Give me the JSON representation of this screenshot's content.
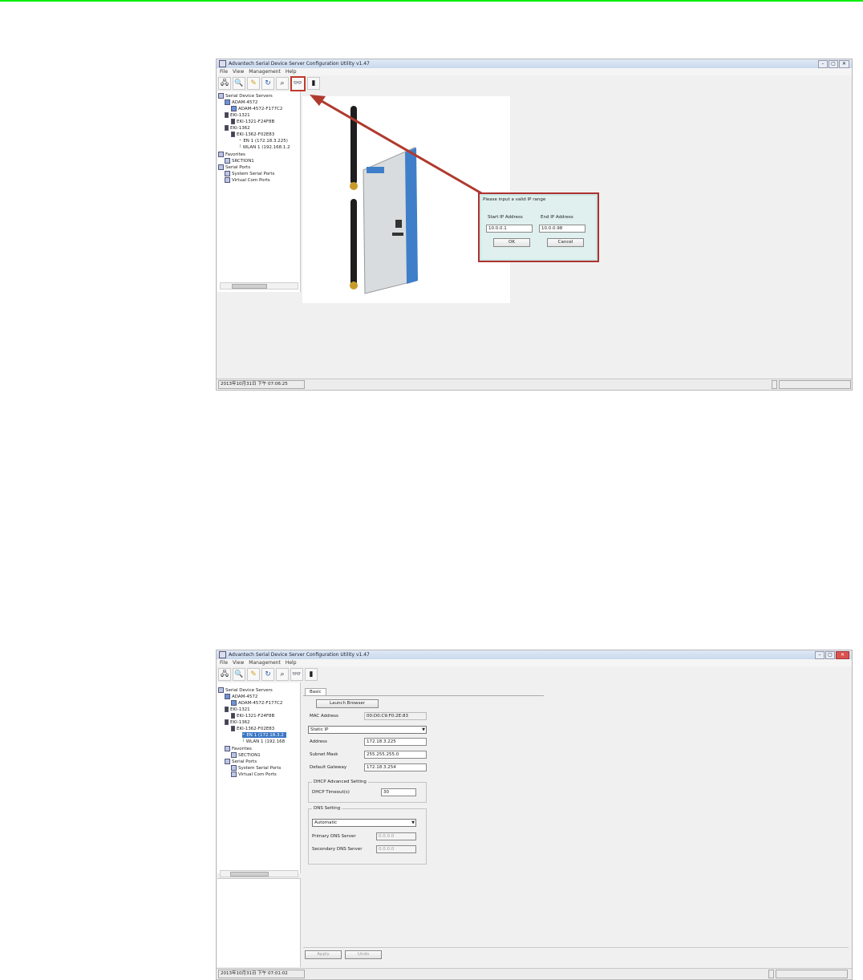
{
  "screenshot_top": {
    "title": "Advantech Serial Device Server Configuration Utility v1.47",
    "window_controls": [
      "–",
      "▢",
      "✕"
    ],
    "menu": [
      "File",
      "View",
      "Management",
      "Help"
    ],
    "toolbar_icons": [
      "network-icon",
      "search-icon",
      "edit-icon",
      "refresh-icon",
      "zoom-icon",
      "binoculars-icon",
      "door-icon"
    ],
    "highlighted_tool": "binoculars-icon",
    "tree": [
      {
        "label": "Serial Device Servers"
      },
      {
        "label": "ADAM-4572"
      },
      {
        "label": "ADAM-4572-F177C2"
      },
      {
        "label": "EKI-1321"
      },
      {
        "label": "EKI-1321-F24F8B"
      },
      {
        "label": "EKI-1362"
      },
      {
        "label": "EKI-1362-F02E83"
      },
      {
        "label": "EN 1 (172.18.3.225)"
      },
      {
        "label": "WLAN 1 (192.168.1.2"
      },
      {
        "label": "Favorites"
      },
      {
        "label": "SRCTION1"
      },
      {
        "label": "Serial Ports"
      },
      {
        "label": "System Serial Ports"
      },
      {
        "label": "Virtual Com Ports"
      }
    ],
    "dialog": {
      "title": "Please input a valid IP range",
      "start_label": "Start IP Address",
      "end_label": "End IP Address",
      "start_value": "10.0.0.1",
      "end_value": "10.0.0.98",
      "ok": "OK",
      "cancel": "Cancel"
    },
    "status": "2013年10月31日 下午 07:06:25",
    "colors": {
      "highlight": "#c0392b",
      "dialog_bg": "#dff0ee"
    }
  },
  "screenshot_bottom": {
    "title": "Advantech Serial Device Server Configuration Utility v1.47",
    "window_controls": [
      "–",
      "▢",
      "✕"
    ],
    "menu": [
      "File",
      "View",
      "Management",
      "Help"
    ],
    "toolbar_icons": [
      "network-icon",
      "search-icon",
      "edit-icon",
      "refresh-icon",
      "zoom-icon",
      "binoculars-icon",
      "door-icon"
    ],
    "tree": [
      {
        "label": "Serial Device Servers"
      },
      {
        "label": "ADAM-4572"
      },
      {
        "label": "ADAM-4572-F177C2"
      },
      {
        "label": "EKI-1321"
      },
      {
        "label": "EKI-1321-F24F8B"
      },
      {
        "label": "EKI-1362"
      },
      {
        "label": "EKI-1362-F02E83"
      },
      {
        "label": "EN 1 (172.18.3.2"
      },
      {
        "label": "WLAN 1 (192.168"
      },
      {
        "label": "Favorites"
      },
      {
        "label": "SECTION1"
      },
      {
        "label": "Serial Ports"
      },
      {
        "label": "System Serial Ports"
      },
      {
        "label": "Virtual Com Ports"
      }
    ],
    "tab": "Basic",
    "launch_browser": "Launch Browser",
    "mac_label": "MAC Address",
    "mac_value": "00:D0:C9:F0:2E:83",
    "ip_mode": "Static IP",
    "address_label": "Address",
    "address_value": "172.18.3.225",
    "subnet_label": "Subnet Mask",
    "subnet_value": "255.255.255.0",
    "gateway_label": "Default Gateway",
    "gateway_value": "172.18.3.254",
    "dhcp_group": "DHCP Advanced Setting",
    "dhcp_timeout_label": "DHCP Timeout(s)",
    "dhcp_timeout_value": "30",
    "dns_group": "DNS Setting",
    "dns_mode": "Automatic",
    "primary_dns_label": "Primary DNS Server",
    "primary_dns_value": "0.0.0.0",
    "secondary_dns_label": "Secondary DNS Server",
    "secondary_dns_value": "0.0.0.0",
    "apply": "Apply",
    "undo": "Undo",
    "status": "2013年10月31日 下午 07:01:02"
  }
}
